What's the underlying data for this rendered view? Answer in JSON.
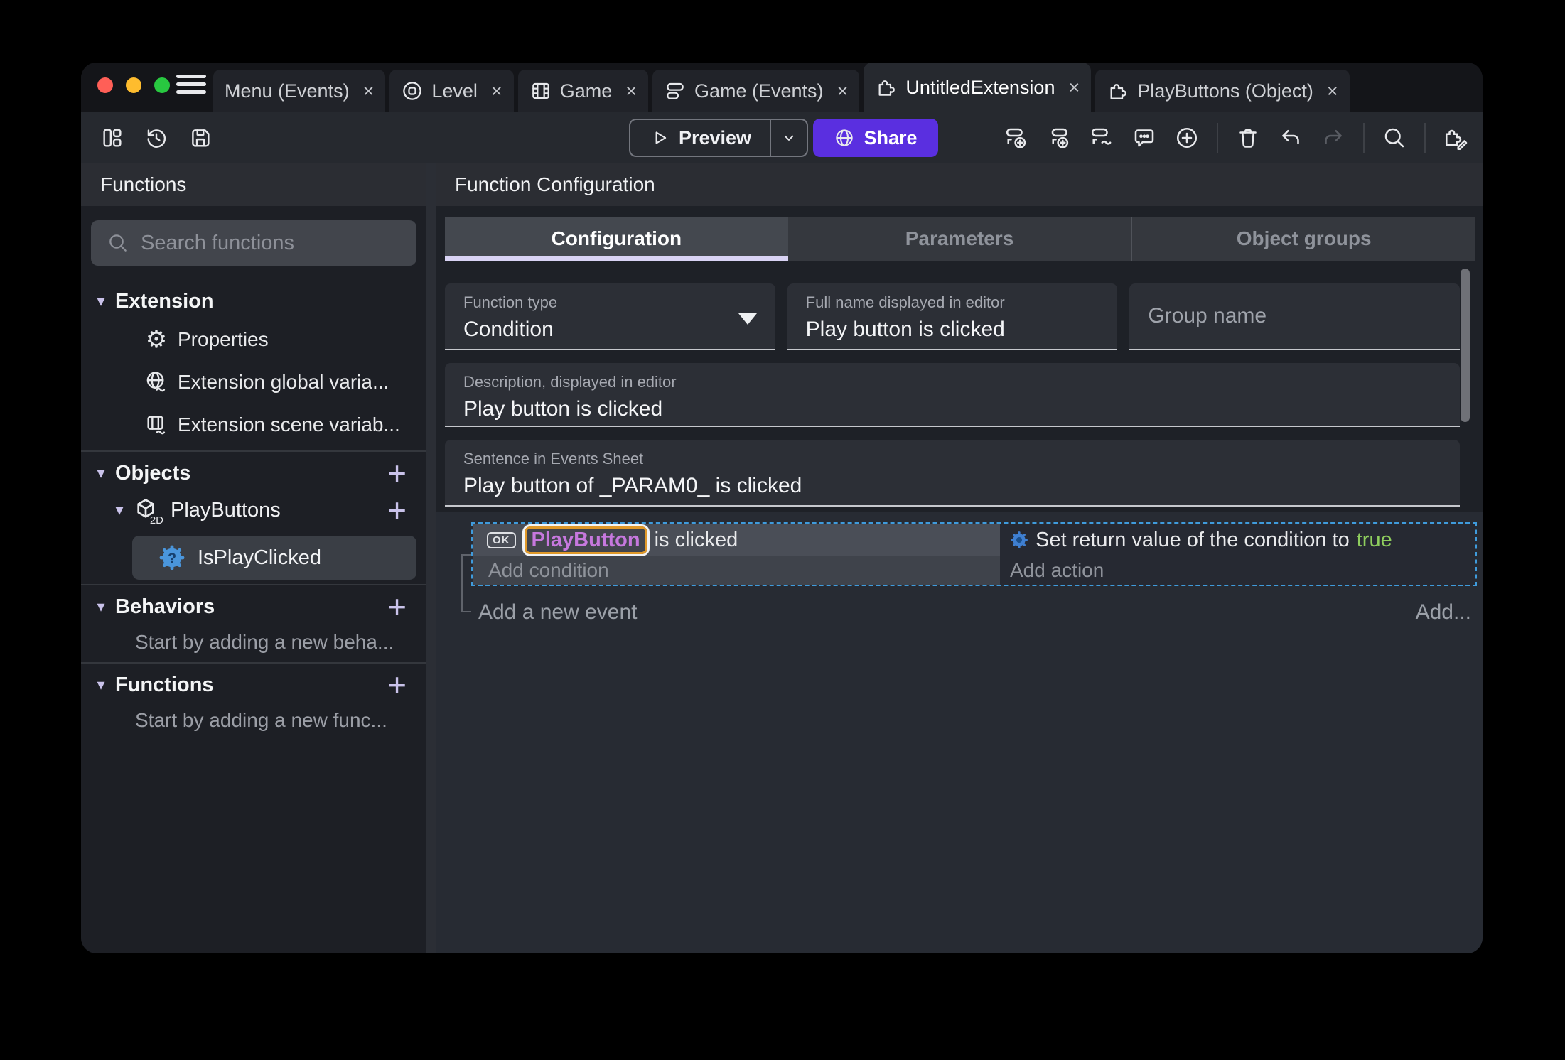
{
  "window": {
    "tab_close": "×",
    "tabs": [
      {
        "label": "Menu (Events)"
      },
      {
        "label": "Level",
        "icon": "scene-icon"
      },
      {
        "label": "Game",
        "icon": "film-icon"
      },
      {
        "label": "Game (Events)",
        "icon": "events-sheet-icon"
      },
      {
        "label": "UntitledExtension",
        "icon": "puzzle-icon",
        "active": true
      },
      {
        "label": "PlayButtons (Object)",
        "icon": "puzzle-icon"
      }
    ]
  },
  "toolbar": {
    "preview_label": "Preview",
    "share_label": "Share"
  },
  "sidebar": {
    "title": "Functions",
    "search_placeholder": "Search functions",
    "extension_label": "Extension",
    "properties_label": "Properties",
    "global_vars_label": "Extension global varia...",
    "scene_vars_label": "Extension scene variab...",
    "objects_label": "Objects",
    "playbuttons_label": "PlayButtons",
    "cube_badge": "2D",
    "isplayclicked_label": "IsPlayClicked",
    "gear_question_mark": "?",
    "behaviors_label": "Behaviors",
    "behaviors_empty": "Start by adding a new beha...",
    "functions_label": "Functions",
    "functions_empty": "Start by adding a new func...",
    "plus": "+",
    "chevron": "▾"
  },
  "main": {
    "title": "Function Configuration",
    "tabs": [
      {
        "label": "Configuration",
        "active": true
      },
      {
        "label": "Parameters"
      },
      {
        "label": "Object groups"
      }
    ],
    "fields": {
      "function_type": {
        "label": "Function type",
        "value": "Condition"
      },
      "full_name": {
        "label": "Full name displayed in editor",
        "value": "Play button is clicked"
      },
      "group_name": {
        "placeholder": "Group name"
      },
      "description": {
        "label": "Description, displayed in editor",
        "value": "Play button is clicked"
      },
      "sentence": {
        "label": "Sentence in Events Sheet",
        "value": "Play button of _PARAM0_ is clicked"
      }
    },
    "events": {
      "condition_object_badge": "OK",
      "condition_object": "PlayButton",
      "condition_text": "is clicked",
      "add_condition_label": "Add condition",
      "action_text": "Set return value of the condition to",
      "action_value": "true",
      "add_action_label": "Add action",
      "add_event_label": "Add a new event",
      "add_more_label": "Add..."
    }
  },
  "colors": {
    "share_button": "#5a2fe0",
    "selection_dashed": "#3f9bdc",
    "object_chip_text": "#c678dd",
    "object_chip_border": "#e0992a",
    "boolean_true": "#8fce5e",
    "function_icon_blue": "#4a96dc",
    "accent_lavender": "#c9c2ea",
    "traffic_red": "#ff5f57",
    "traffic_yellow": "#febc2e",
    "traffic_green": "#28c840"
  }
}
